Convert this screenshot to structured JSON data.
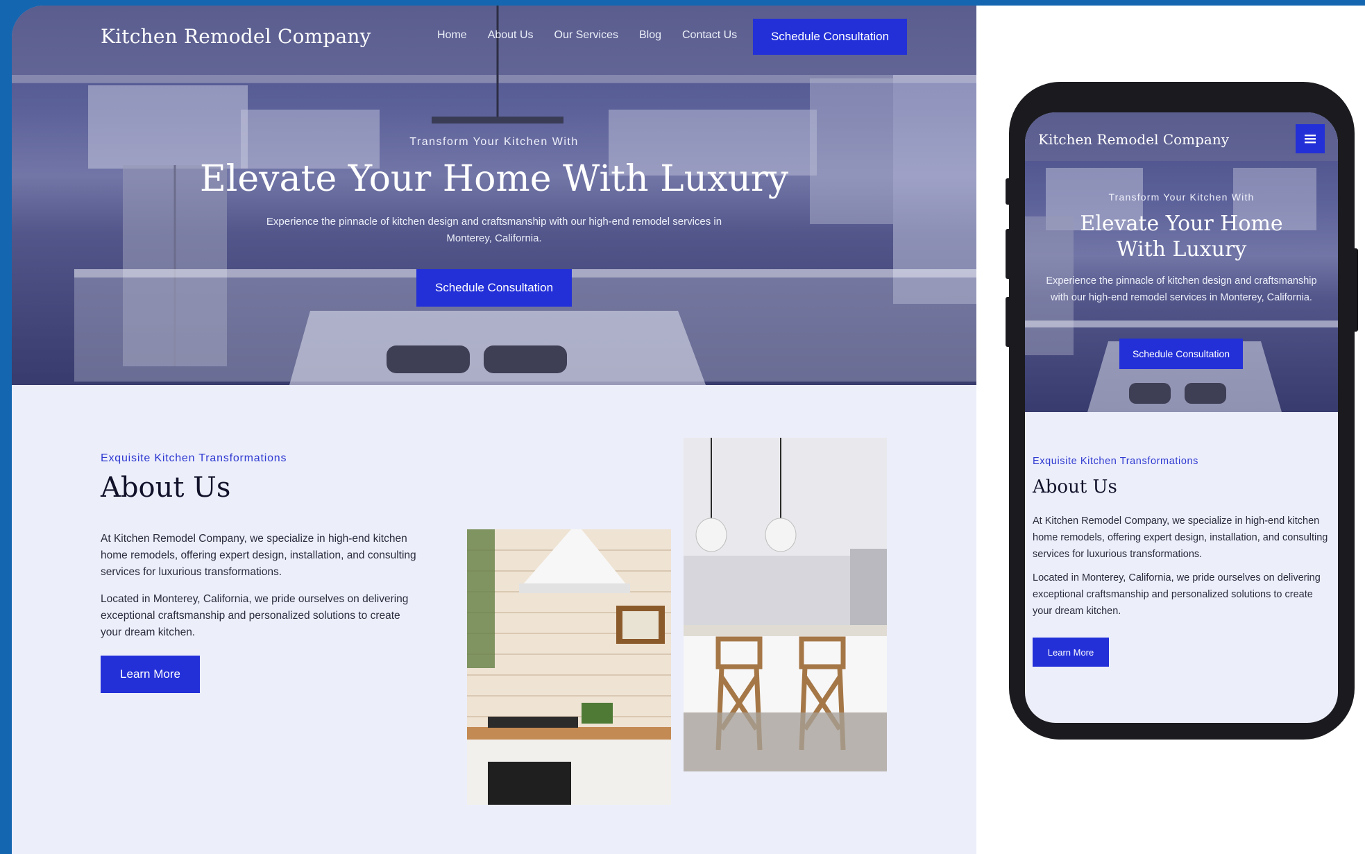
{
  "desktop": {
    "logo": "Kitchen Remodel Company",
    "nav": [
      "Home",
      "About Us",
      "Our Services",
      "Blog",
      "Contact Us"
    ],
    "nav_cta": "Schedule Consultation",
    "hero": {
      "eyebrow": "Transform Your Kitchen With",
      "title": "Elevate Your Home With Luxury",
      "text": "Experience the pinnacle of kitchen design and craftsmanship with our high-end remodel services in Monterey, California.",
      "cta": "Schedule Consultation"
    },
    "about": {
      "eyebrow": "Exquisite Kitchen Transformations",
      "title": "About Us",
      "p1": "At Kitchen Remodel Company, we specialize in high-end kitchen home remodels, offering expert design, installation, and consulting services for luxurious transformations.",
      "p2": "Located in Monterey, California, we pride ourselves on delivering exceptional craftsmanship and personalized solutions to create your dream kitchen.",
      "cta": "Learn More"
    }
  },
  "mobile": {
    "logo": "Kitchen Remodel Company",
    "menu_icon": "hamburger-icon",
    "hero": {
      "eyebrow": "Transform Your Kitchen With",
      "title": "Elevate Your Home With Luxury",
      "text": "Experience the pinnacle of kitchen design and craftsmanship with our high-end remodel services in Monterey, California.",
      "cta": "Schedule Consultation"
    },
    "about": {
      "eyebrow": "Exquisite Kitchen Transformations",
      "title": "About Us",
      "p1": "At Kitchen Remodel Company, we specialize in high-end kitchen home remodels, offering expert design, installation, and consulting services for luxurious transformations.",
      "p2": "Located in Monterey, California, we pride ourselves on delivering exceptional craftsmanship and personalized solutions to create your dream kitchen.",
      "cta": "Learn More"
    }
  },
  "colors": {
    "background": "#1566b0",
    "accent": "#2330d8",
    "page": "#eceefa",
    "heading": "#11122a"
  }
}
